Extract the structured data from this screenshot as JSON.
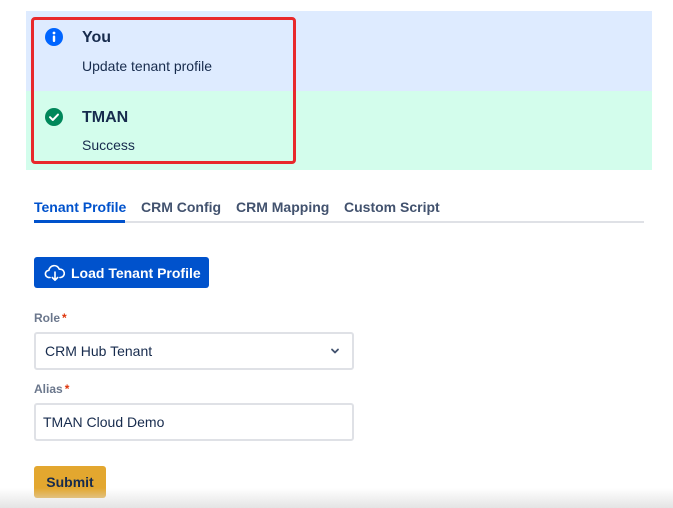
{
  "flags": {
    "info": {
      "icon": "info-icon",
      "title": "You",
      "description": "Update tenant profile",
      "icon_color": "#0065ff",
      "bg": "#deebff"
    },
    "success": {
      "icon": "check-circle-icon",
      "title": "TMAN",
      "description": "Success",
      "icon_color": "#00875a",
      "bg": "#d3fdec"
    }
  },
  "tabs": [
    {
      "label": "Tenant Profile",
      "active": true
    },
    {
      "label": "CRM Config",
      "active": false
    },
    {
      "label": "CRM Mapping",
      "active": false
    },
    {
      "label": "Custom Script",
      "active": false
    }
  ],
  "load_button": {
    "label": "Load Tenant Profile",
    "icon": "cloud-download-icon"
  },
  "form": {
    "role": {
      "label": "Role",
      "required_mark": "*",
      "value": "CRM Hub Tenant",
      "icon": "chevron-down-icon"
    },
    "alias": {
      "label": "Alias",
      "required_mark": "*",
      "value": "TMAN Cloud Demo"
    }
  },
  "submit_button": {
    "label": "Submit"
  },
  "colors": {
    "primary": "#0052cc",
    "submit": "#e3a72f",
    "highlight": "#e8282b",
    "required": "#de350b"
  }
}
